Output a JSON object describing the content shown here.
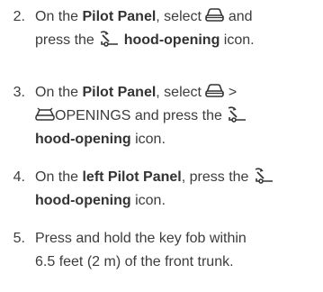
{
  "steps": [
    {
      "number": "2.",
      "line1_a": "On the ",
      "line1_bold": "Pilot Panel",
      "line1_b": ", select ",
      "line1_c": " and",
      "line2_a": "press the ",
      "line2_bold": "hood-opening",
      "line2_b": " icon.",
      "icons": [
        "car-front-icon",
        "hood-opening-icon"
      ]
    },
    {
      "number": "3.",
      "line1_a": "On the ",
      "line1_bold": "Pilot Panel",
      "line1_b": ", select ",
      "line1_c": " >",
      "line2_a": "OPENINGS and press the ",
      "line3_bold": "hood-opening",
      "line3_b": " icon.",
      "icons": [
        "car-front-icon",
        "car-openings-icon",
        "hood-opening-icon"
      ]
    },
    {
      "number": "4.",
      "line1_a": "On the ",
      "line1_bold": "left Pilot Panel",
      "line1_b": ", press the ",
      "line2_bold": "hood-opening",
      "line2_b": " icon.",
      "icons": [
        "hood-opening-icon"
      ]
    },
    {
      "number": "5.",
      "line1": "Press and hold the key fob within",
      "line2": "6.5 feet (2 m) of the front trunk."
    }
  ]
}
